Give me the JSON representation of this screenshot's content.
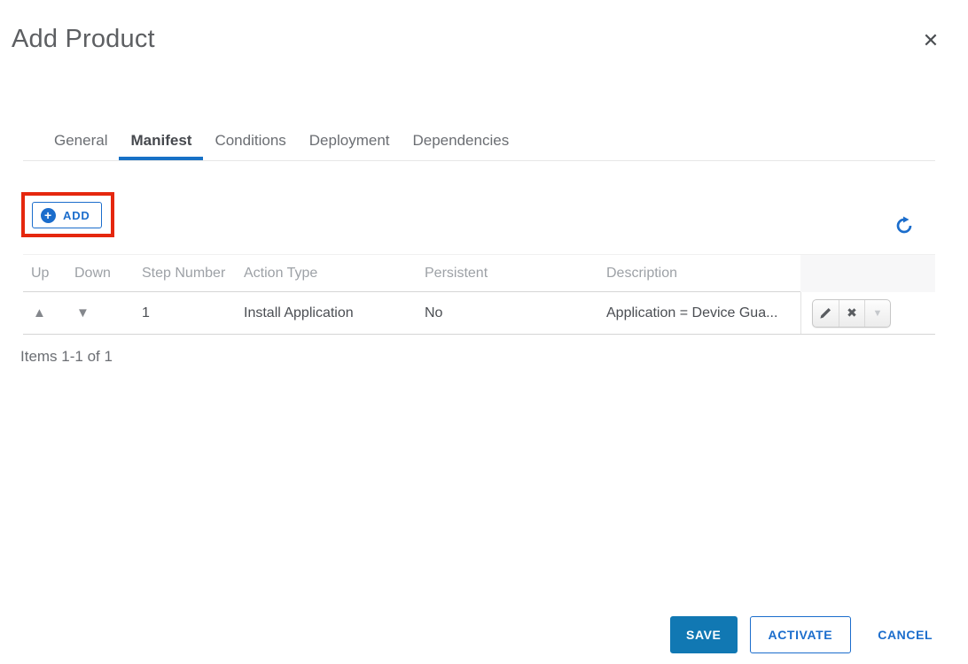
{
  "dialog": {
    "title": "Add Product"
  },
  "tabs": {
    "active": "Manifest",
    "items": [
      {
        "label": "General"
      },
      {
        "label": "Manifest"
      },
      {
        "label": "Conditions"
      },
      {
        "label": "Deployment"
      },
      {
        "label": "Dependencies"
      }
    ]
  },
  "toolbar": {
    "add_label": "ADD",
    "plus_glyph": "+"
  },
  "grid": {
    "columns": {
      "up": "Up",
      "down": "Down",
      "step_number": "Step Number",
      "action_type": "Action Type",
      "persistent": "Persistent",
      "description": "Description"
    },
    "row": {
      "up_glyph": "▲",
      "down_glyph": "▼",
      "step_number": "1",
      "action_type": "Install Application",
      "persistent": "No",
      "description": "Application = Device Gua...",
      "delete_glyph": "✖",
      "expand_glyph": "▼"
    },
    "pagination": "Items 1-1 of 1"
  },
  "footer": {
    "save_label": "SAVE",
    "activate_label": "ACTIVATE",
    "cancel_label": "CANCEL"
  },
  "icons": {
    "close_glyph": "✕"
  },
  "colors": {
    "accent_blue": "#1b6dcc",
    "primary_button": "#1178b3",
    "tab_underline": "#1771c6",
    "annotation_red": "#e5270e"
  }
}
